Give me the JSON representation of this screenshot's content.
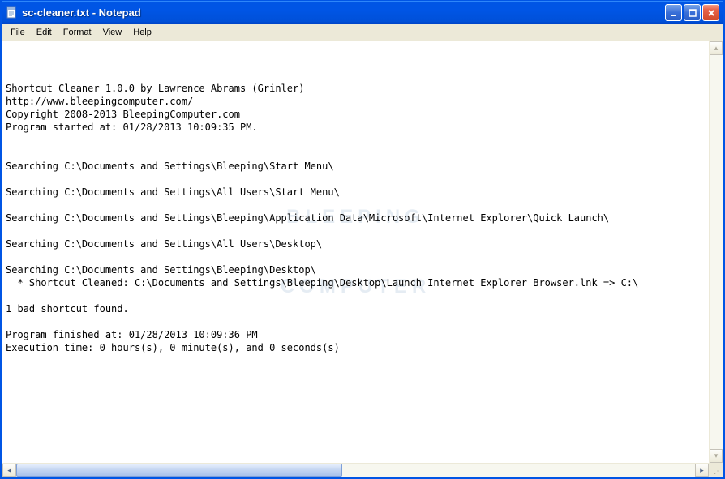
{
  "window": {
    "title": "sc-cleaner.txt - Notepad"
  },
  "menu": {
    "file": "File",
    "edit": "Edit",
    "format": "Format",
    "view": "View",
    "help": "Help"
  },
  "content": {
    "lines": [
      "Shortcut Cleaner 1.0.0 by Lawrence Abrams (Grinler)",
      "http://www.bleepingcomputer.com/",
      "Copyright 2008-2013 BleepingComputer.com",
      "Program started at: 01/28/2013 10:09:35 PM.",
      "",
      "",
      "Searching C:\\Documents and Settings\\Bleeping\\Start Menu\\",
      "",
      "Searching C:\\Documents and Settings\\All Users\\Start Menu\\",
      "",
      "Searching C:\\Documents and Settings\\Bleeping\\Application Data\\Microsoft\\Internet Explorer\\Quick Launch\\",
      "",
      "Searching C:\\Documents and Settings\\All Users\\Desktop\\",
      "",
      "Searching C:\\Documents and Settings\\Bleeping\\Desktop\\",
      "  * Shortcut Cleaned: C:\\Documents and Settings\\Bleeping\\Desktop\\Launch Internet Explorer Browser.lnk => C:\\",
      "",
      "1 bad shortcut found.",
      "",
      "Program finished at: 01/28/2013 10:09:36 PM",
      "Execution time: 0 hours(s), 0 minute(s), and 0 seconds(s)"
    ]
  },
  "watermark": {
    "line1": "BLEEPING",
    "line2": "COMPUTER"
  }
}
